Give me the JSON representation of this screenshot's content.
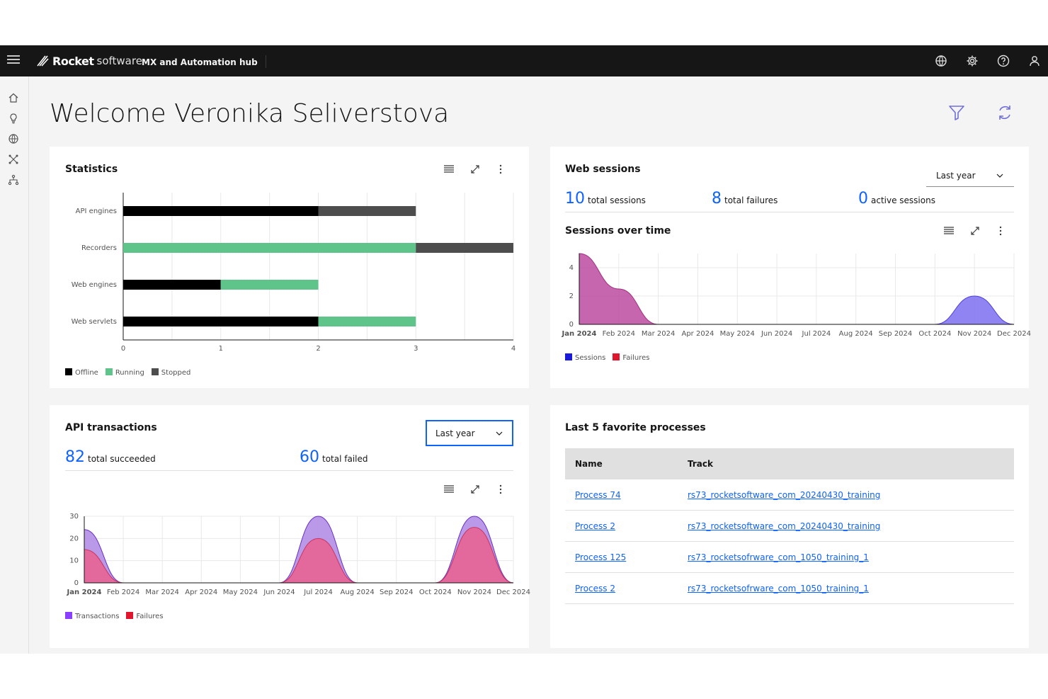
{
  "header": {
    "brand_logo": "Rocket",
    "brand_suffix": "software",
    "app_name": "MX and Automation hub"
  },
  "page": {
    "welcome": "Welcome Veronika Seliverstova"
  },
  "statistics": {
    "title": "Statistics",
    "legend": [
      "Offline",
      "Running",
      "Stopped"
    ],
    "colors": {
      "Offline": "#000000",
      "Running": "#5fc48a",
      "Stopped": "#4d4d4d"
    }
  },
  "web_sessions": {
    "title": "Web sessions",
    "period": "Last year",
    "stats": [
      {
        "value": "10",
        "label": "total sessions"
      },
      {
        "value": "8",
        "label": "total failures"
      },
      {
        "value": "0",
        "label": "active sessions"
      }
    ],
    "sub_title": "Sessions over time",
    "legend": [
      "Sessions",
      "Failures"
    ]
  },
  "api_transactions": {
    "title": "API transactions",
    "period": "Last year",
    "stats": [
      {
        "value": "82",
        "label": "total succeeded"
      },
      {
        "value": "60",
        "label": "total failed"
      }
    ],
    "legend": [
      "Transactions",
      "Failures"
    ]
  },
  "favorites": {
    "title": "Last 5 favorite processes",
    "columns": [
      "Name",
      "Track"
    ],
    "rows": [
      {
        "name": "Process 74",
        "track": "rs73_rocketsoftware_com_20240430_training"
      },
      {
        "name": "Process 2",
        "track": "rs73_rocketsoftware_com_20240430_training"
      },
      {
        "name": "Process 125",
        "track": "rs73_rocketsofrware_com_1050_training_1"
      },
      {
        "name": "Process 2",
        "track": "rs73_rocketsofrware_com_1050_training_1"
      }
    ]
  },
  "chart_data": [
    {
      "type": "bar",
      "orientation": "horizontal",
      "stacked": true,
      "categories": [
        "API engines",
        "Recorders",
        "Web engines",
        "Web servlets"
      ],
      "series": [
        {
          "name": "Offline",
          "values": [
            2,
            0,
            1,
            2
          ]
        },
        {
          "name": "Running",
          "values": [
            0,
            3,
            1,
            1
          ]
        },
        {
          "name": "Stopped",
          "values": [
            1,
            1,
            0,
            0
          ]
        }
      ],
      "xlim": [
        0,
        4
      ],
      "xticks": [
        "0",
        "1",
        "2",
        "3",
        "4"
      ],
      "grid": true,
      "legend_position": "bottom-left"
    },
    {
      "type": "area",
      "x": [
        "Jan 2024",
        "Feb 2024",
        "Mar 2024",
        "Apr 2024",
        "May 2024",
        "Jun 2024",
        "Jul 2024",
        "Aug 2024",
        "Sep 2024",
        "Oct 2024",
        "Nov 2024",
        "Dec 2024"
      ],
      "series": [
        {
          "name": "Sessions",
          "values": [
            0,
            0,
            0,
            0,
            0,
            0,
            0,
            0,
            0,
            0,
            2,
            0
          ]
        },
        {
          "name": "Failures",
          "values": [
            5,
            2.5,
            0,
            0,
            0,
            0,
            0,
            0,
            0,
            0,
            0,
            0
          ]
        }
      ],
      "ylim": [
        0,
        5
      ],
      "yticks": [
        "0",
        "2",
        "4"
      ],
      "grid": true,
      "legend_position": "bottom-left"
    },
    {
      "type": "area",
      "x": [
        "Jan 2024",
        "Feb 2024",
        "Mar 2024",
        "Apr 2024",
        "May 2024",
        "Jun 2024",
        "Jul 2024",
        "Aug 2024",
        "Sep 2024",
        "Oct 2024",
        "Nov 2024",
        "Dec 2024"
      ],
      "series": [
        {
          "name": "Transactions",
          "values": [
            24,
            0,
            0,
            0,
            0,
            0,
            30,
            0,
            0,
            0,
            30,
            0
          ]
        },
        {
          "name": "Failures",
          "values": [
            15,
            0,
            0,
            0,
            0,
            0,
            20,
            0,
            0,
            0,
            25,
            0
          ]
        }
      ],
      "ylim": [
        0,
        30
      ],
      "yticks": [
        "0",
        "10",
        "20",
        "30"
      ],
      "grid": true,
      "legend_position": "bottom-left"
    }
  ]
}
